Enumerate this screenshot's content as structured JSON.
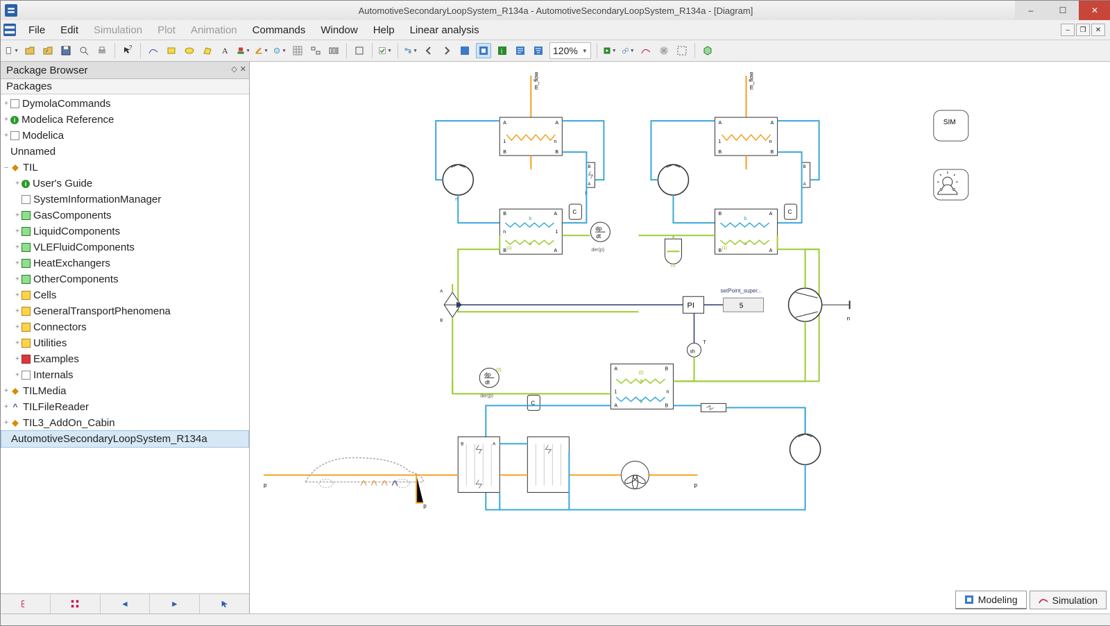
{
  "window": {
    "title": "AutomotiveSecondaryLoopSystem_R134a - AutomotiveSecondaryLoopSystem_R134a - [Diagram]"
  },
  "menus": {
    "file": "File",
    "edit": "Edit",
    "simulation": "Simulation",
    "plot": "Plot",
    "animation": "Animation",
    "commands": "Commands",
    "window": "Window",
    "help": "Help",
    "linear": "Linear analysis"
  },
  "toolbar": {
    "zoom": "120%"
  },
  "sidebar": {
    "title": "Package Browser",
    "packages_label": "Packages",
    "items": [
      {
        "label": "DymolaCommands",
        "depth": 0,
        "icon": "box-w",
        "tw": "+"
      },
      {
        "label": "Modelica Reference",
        "depth": 0,
        "icon": "info",
        "tw": "+"
      },
      {
        "label": "Modelica",
        "depth": 0,
        "icon": "box-w",
        "tw": "+",
        "faded": true
      },
      {
        "label": "Unnamed",
        "depth": 0,
        "icon": "",
        "tw": ""
      },
      {
        "label": "TIL",
        "depth": 0,
        "icon": "logo-y",
        "tw": "–"
      },
      {
        "label": "User's Guide",
        "depth": 1,
        "icon": "info",
        "tw": "+"
      },
      {
        "label": "SystemInformationManager",
        "depth": 1,
        "icon": "box-w",
        "tw": ""
      },
      {
        "label": "GasComponents",
        "depth": 1,
        "icon": "box-g",
        "tw": "+"
      },
      {
        "label": "LiquidComponents",
        "depth": 1,
        "icon": "box-g",
        "tw": "+"
      },
      {
        "label": "VLEFluidComponents",
        "depth": 1,
        "icon": "box-g",
        "tw": "+"
      },
      {
        "label": "HeatExchangers",
        "depth": 1,
        "icon": "box-g",
        "tw": "+"
      },
      {
        "label": "OtherComponents",
        "depth": 1,
        "icon": "box-g",
        "tw": "+"
      },
      {
        "label": "Cells",
        "depth": 1,
        "icon": "box-y",
        "tw": "+"
      },
      {
        "label": "GeneralTransportPhenomena",
        "depth": 1,
        "icon": "box-y",
        "tw": "+"
      },
      {
        "label": "Connectors",
        "depth": 1,
        "icon": "box-y",
        "tw": "+"
      },
      {
        "label": "Utilities",
        "depth": 1,
        "icon": "box-y",
        "tw": "+"
      },
      {
        "label": "Examples",
        "depth": 1,
        "icon": "box-r",
        "tw": "+"
      },
      {
        "label": "Internals",
        "depth": 1,
        "icon": "box-w",
        "tw": "+"
      },
      {
        "label": "TILMedia",
        "depth": 0,
        "icon": "logo-y",
        "tw": "+"
      },
      {
        "label": "TILFileReader",
        "depth": 0,
        "icon": "logo-b",
        "tw": "+"
      },
      {
        "label": "TIL3_AddOn_Cabin",
        "depth": 0,
        "icon": "logo-y",
        "tw": "+"
      },
      {
        "label": "AutomotiveSecondaryLoopSystem_R134a",
        "depth": 0,
        "icon": "",
        "tw": "",
        "selected": true
      }
    ]
  },
  "diagram": {
    "sim_box": "SIM",
    "mflow_left": "m_flow",
    "mflow_right": "m_flow",
    "dp_dt_1": "dp",
    "dt_1": "dt",
    "derp_1": "der(p)",
    "dp_dt_2": "dp",
    "dt_2": "dt",
    "derp_2": "der(p)",
    "pi_label": "PI",
    "setpoint_label": "setPoint_super...",
    "setpoint_value": "5",
    "sh_label": "sh",
    "n_label": "n",
    "p_label_l": "p",
    "p_label_r": "p",
    "p_label_br": "p",
    "A": "A",
    "B": "B",
    "C": "C",
    "one": "1",
    "n2": "n",
    "a": "a",
    "b": "b",
    "p": "p",
    "t": "T",
    "sh": "sh",
    "idx1": "(1)",
    "idx2": "(2)"
  },
  "mode_tabs": {
    "modeling": "Modeling",
    "simulation": "Simulation"
  }
}
